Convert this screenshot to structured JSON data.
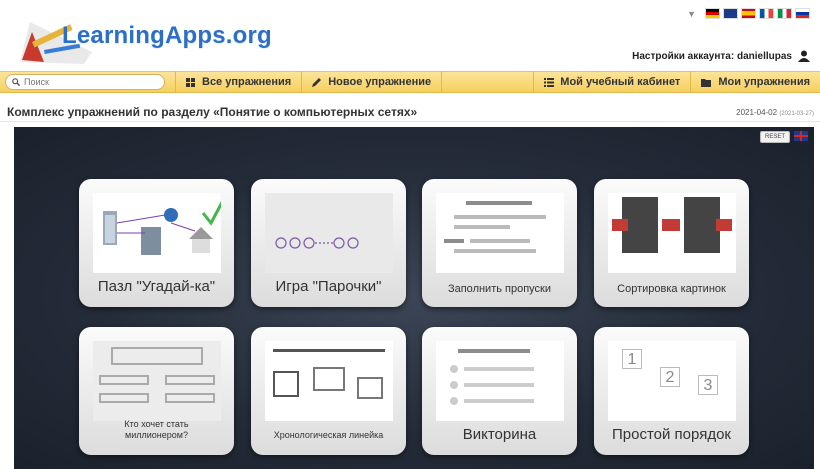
{
  "header": {
    "logo_text": "LearningApps.org",
    "account_label": "Настройки аккаунта: daniellupas"
  },
  "toolbar": {
    "search_placeholder": "Поиск",
    "all_exercises": "Все упражнения",
    "new_exercise": "Новое упражнение",
    "my_cabinet": "Мой учебный кабинет",
    "my_exercises": "Мои упражнения"
  },
  "page": {
    "title": "Комплекс упражнений по разделу «Понятие о компьютерных сетях»",
    "date": "2021-04-02",
    "date_small": "(2021-03-27)"
  },
  "stage": {
    "reset_label": "RESET",
    "tiles": [
      {
        "label": "Пазл \"Угадай-ка\""
      },
      {
        "label": "Игра \"Парочки\""
      },
      {
        "label": "Заполнить пропуски"
      },
      {
        "label": "Сортировка картинок"
      },
      {
        "label": "Кто хочет стать миллионером?"
      },
      {
        "label": "Хронологическая линейка"
      },
      {
        "label": "Викторина"
      },
      {
        "label": "Простой порядок"
      }
    ]
  },
  "colors": {
    "toolbar": "#f6cf5e",
    "logo": "#2b6fc7",
    "stage": "#252c39"
  }
}
